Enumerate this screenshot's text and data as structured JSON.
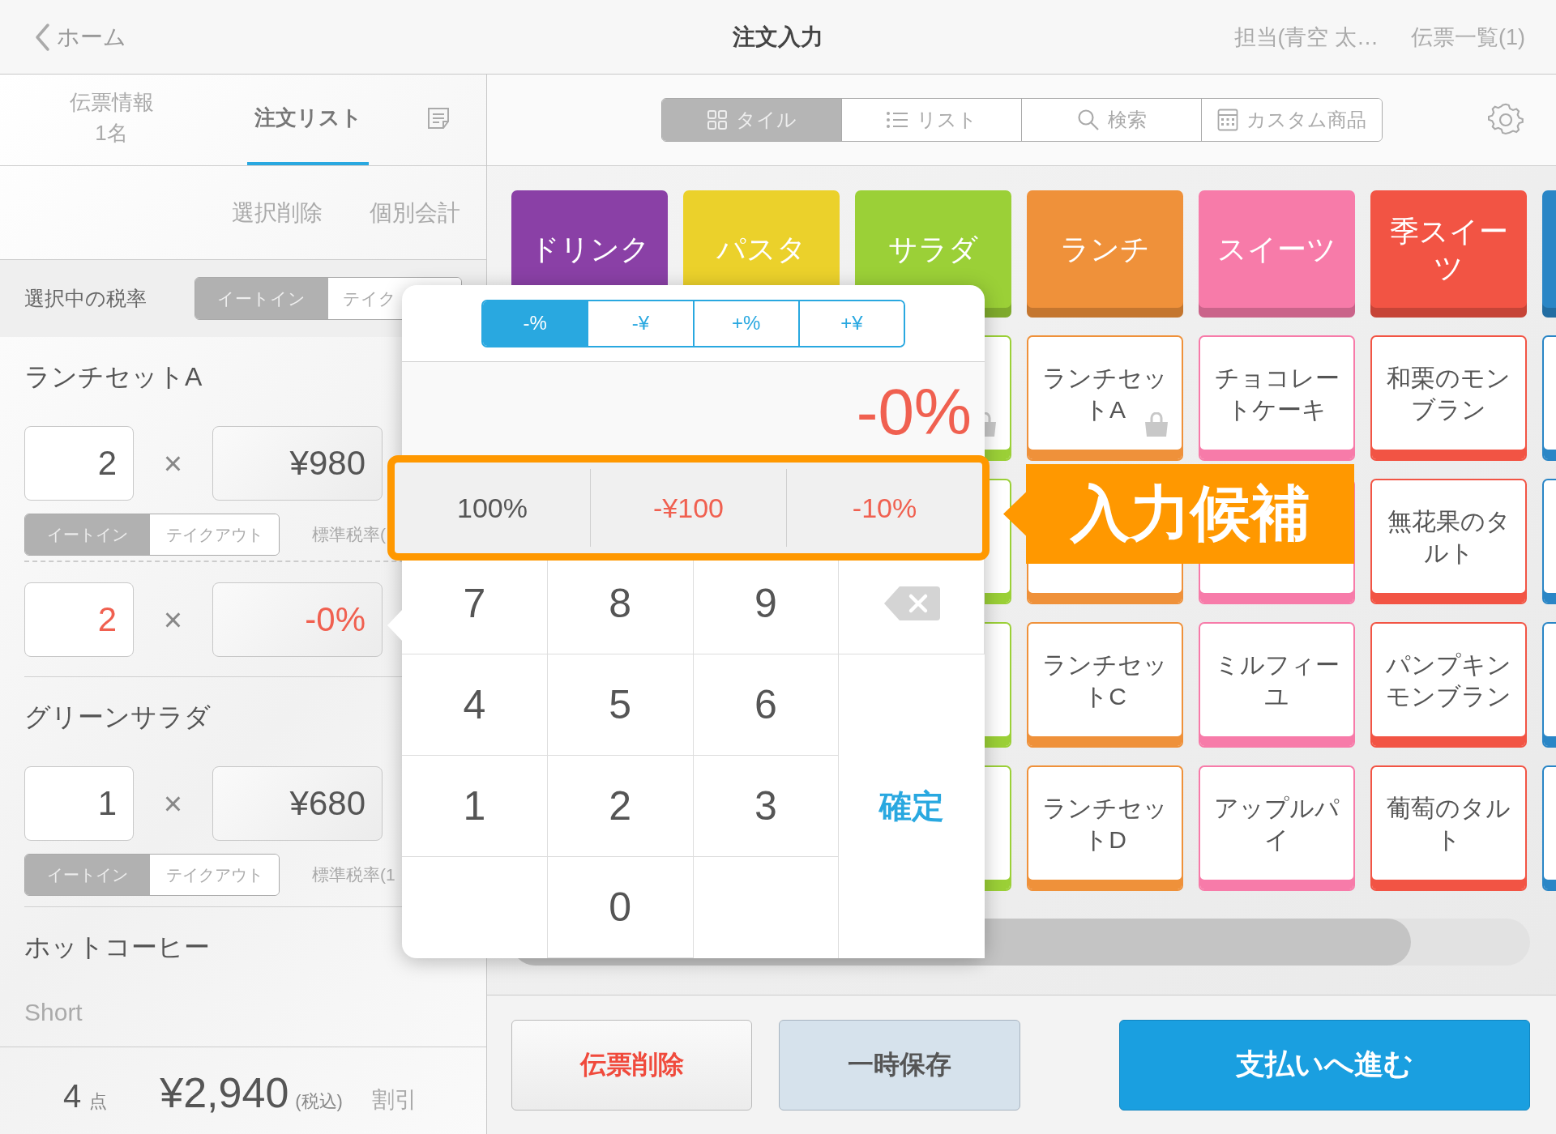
{
  "header": {
    "back": "ホーム",
    "title": "注文入力",
    "staff": "担当(青空 太…",
    "slips": "伝票一覧(1)"
  },
  "order_tabs": [
    {
      "label": "伝票情報",
      "detail": "1名",
      "selected": false
    },
    {
      "label": "注文リスト",
      "selected": true
    }
  ],
  "order_actions": [
    "選択削除",
    "個別会計"
  ],
  "tax_selector": {
    "label": "選択中の税率",
    "options": [
      {
        "label": "イートイン",
        "selected": true
      },
      {
        "label": "テイク",
        "selected": false
      }
    ]
  },
  "order_items": [
    {
      "name": "ランチセットA",
      "lines": [
        {
          "kind": "price",
          "qty": "2",
          "operator": "×",
          "amount": "¥980",
          "options": [
            {
              "label": "イートイン",
              "selected": true
            },
            {
              "label": "テイクアウト",
              "selected": false
            }
          ],
          "tax_note": "標準税率("
        },
        {
          "kind": "discount",
          "qty": "2",
          "operator": "×",
          "amount": "-0%"
        }
      ]
    },
    {
      "name": "グリーンサラダ",
      "lines": [
        {
          "kind": "price",
          "qty": "1",
          "operator": "×",
          "amount": "¥680",
          "options": [
            {
              "label": "イートイン",
              "selected": true
            },
            {
              "label": "テイクアウト",
              "selected": false
            }
          ],
          "tax_note": "標準税率(1"
        }
      ]
    },
    {
      "name": "ホットコーヒー",
      "option": "Short"
    }
  ],
  "totals": {
    "count": "4",
    "count_unit": "点",
    "amount": "¥2,940",
    "tax_note": "(税込)",
    "discount": "割引"
  },
  "view_modes": [
    {
      "label": "タイル",
      "selected": true
    },
    {
      "label": "リスト",
      "selected": false
    },
    {
      "label": "検索",
      "selected": false
    },
    {
      "label": "カスタム商品",
      "selected": false
    }
  ],
  "categories": [
    {
      "label": "ドリンク",
      "color": "#8a40a6"
    },
    {
      "label": "パスタ",
      "color": "#ebd12b"
    },
    {
      "label": "サラダ",
      "color": "#9bd037"
    },
    {
      "label": "ランチ",
      "color": "#ef913a"
    },
    {
      "label": "スイーツ",
      "color": "#f77ba9"
    },
    {
      "label": "季スイーツ",
      "color": "#f25444"
    },
    {
      "color": "#2a86c6"
    }
  ],
  "product_rows": [
    [
      {
        "color": "#9bd037",
        "bag": true
      },
      {
        "label": "ランチセットA",
        "color": "#ef913a",
        "bag": true
      },
      {
        "label": "チョコレートケーキ",
        "color": "#f77ba9",
        "bag": false
      },
      {
        "label": "和栗のモンブラン",
        "color": "#f25444",
        "bag": false
      },
      {
        "color": "#2a86c6"
      }
    ],
    [
      {
        "color": "#9bd037",
        "bag": false
      },
      {
        "color": "#ef913a",
        "bag": false
      },
      {
        "color": "#f77ba9",
        "bag": false
      },
      {
        "label": "無花果のタルト",
        "color": "#f25444",
        "bag": false
      },
      {
        "color": "#2a86c6"
      }
    ],
    [
      {
        "color": "#9bd037",
        "bag": false
      },
      {
        "label": "ランチセットC",
        "color": "#ef913a",
        "bag": false
      },
      {
        "label": "ミルフィーユ",
        "color": "#f77ba9",
        "bag": false
      },
      {
        "label": "パンプキンモンブラン",
        "color": "#f25444",
        "bag": false
      },
      {
        "color": "#2a86c6"
      }
    ],
    [
      {
        "color": "#9bd037",
        "bag": false
      },
      {
        "label": "ランチセットD",
        "color": "#ef913a",
        "bag": false
      },
      {
        "label": "アップルパイ",
        "color": "#f77ba9",
        "bag": false
      },
      {
        "label": "葡萄のタルト",
        "color": "#f25444",
        "bag": false
      },
      {
        "color": "#2a86c6"
      }
    ]
  ],
  "discount_popup": {
    "modes": [
      {
        "label": "-%",
        "selected": true
      },
      {
        "label": "-¥",
        "selected": false
      },
      {
        "label": "+%",
        "selected": false
      },
      {
        "label": "+¥",
        "selected": false
      }
    ],
    "display": "-0%",
    "suggestions": [
      {
        "label": "100%",
        "kind": "neutral"
      },
      {
        "label": "-¥100",
        "kind": "discount"
      },
      {
        "label": "-10%",
        "kind": "discount"
      }
    ],
    "keys": [
      "7",
      "8",
      "9",
      "4",
      "5",
      "6",
      "1",
      "2",
      "3",
      "0"
    ],
    "confirm": "確定"
  },
  "callout": "入力候補",
  "footer_buttons": [
    {
      "label": "伝票削除",
      "kind": "delete"
    },
    {
      "label": "一時保存",
      "kind": "hold"
    },
    {
      "label": "支払いへ進む",
      "kind": "pay"
    }
  ]
}
